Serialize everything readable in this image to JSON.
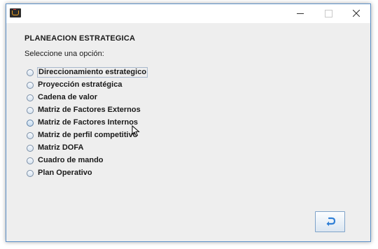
{
  "window": {
    "app_icon": "java-cup-icon",
    "controls": {
      "minimize_icon": "minimize-icon",
      "maximize_icon": "maximize-icon",
      "close_icon": "close-icon"
    }
  },
  "main": {
    "title": "PLANEACION ESTRATEGICA",
    "prompt": "Seleccione una opción:",
    "options": [
      {
        "label": "Direccionamiento estrategico",
        "selected": false,
        "focused": true
      },
      {
        "label": "Proyección estratégica",
        "selected": false
      },
      {
        "label": "Cadena de valor",
        "selected": false
      },
      {
        "label": "Matriz de Factores Externos",
        "selected": false
      },
      {
        "label": "Matriz de Factores Internos",
        "selected": false,
        "hovered": true
      },
      {
        "label": "Matriz de perfil competitivo",
        "selected": false
      },
      {
        "label": "Matriz DOFA",
        "selected": false
      },
      {
        "label": "Cuadro de mando",
        "selected": false
      },
      {
        "label": "Plan Operativo",
        "selected": false
      }
    ],
    "back_button": {
      "icon": "return-arrow-icon"
    }
  },
  "colors": {
    "window_background": "#eeeeee",
    "window_border": "#5a8fc7",
    "accent": "#2f7fd6"
  }
}
